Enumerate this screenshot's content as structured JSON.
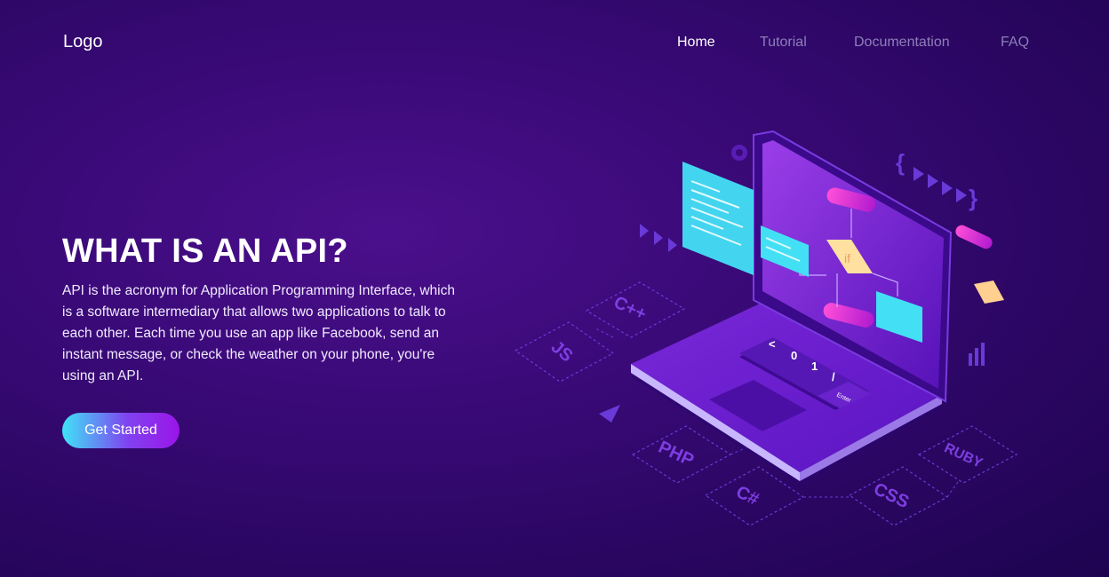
{
  "header": {
    "logo": "Logo",
    "nav": [
      {
        "label": "Home",
        "active": true
      },
      {
        "label": "Tutorial",
        "active": false
      },
      {
        "label": "Documentation",
        "active": false
      },
      {
        "label": "FAQ",
        "active": false
      }
    ]
  },
  "hero": {
    "title": "WHAT IS AN API?",
    "body": "API is the acronym for Application Programming Interface, which is a software intermediary that allows two applications to talk to each other. Each time you use an app like Facebook, send an instant message, or check the weather on your phone, you're using an API.",
    "cta_label": "Get Started"
  },
  "illustration": {
    "language_tiles": [
      "C++",
      "JS",
      "PHP",
      "C#",
      "CSS",
      "RUBY"
    ],
    "keyboard_keys": [
      "<",
      "0",
      "1",
      "/",
      ">"
    ],
    "enter_key": "Enter",
    "flowchart_condition": "if",
    "colors": {
      "accent_cyan": "#43e0f5",
      "accent_purple": "#8b1be8",
      "tile_border": "#6a3ad8",
      "background": "#3a0a78"
    }
  }
}
